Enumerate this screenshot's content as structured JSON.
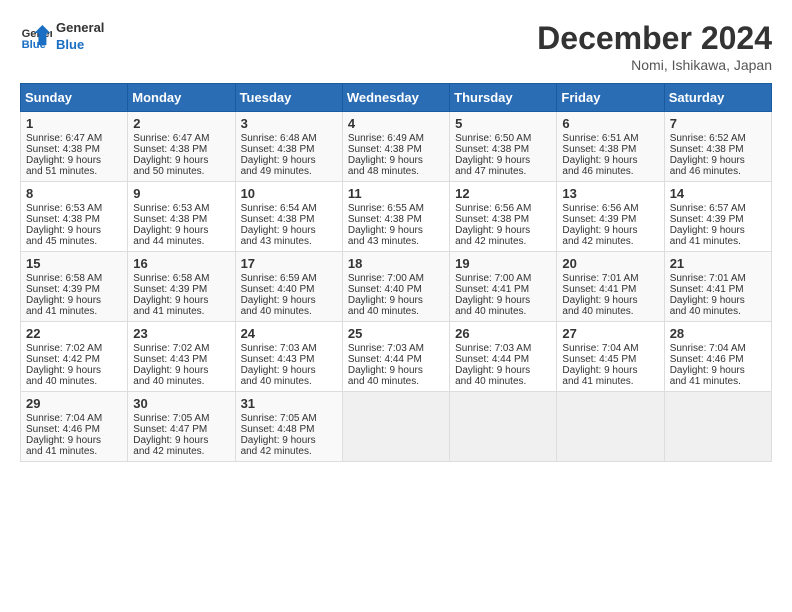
{
  "header": {
    "logo_line1": "General",
    "logo_line2": "Blue",
    "month_title": "December 2024",
    "location": "Nomi, Ishikawa, Japan"
  },
  "weekdays": [
    "Sunday",
    "Monday",
    "Tuesday",
    "Wednesday",
    "Thursday",
    "Friday",
    "Saturday"
  ],
  "weeks": [
    [
      {
        "day": "1",
        "info": "Sunrise: 6:47 AM\nSunset: 4:38 PM\nDaylight: 9 hours\nand 51 minutes."
      },
      {
        "day": "2",
        "info": "Sunrise: 6:47 AM\nSunset: 4:38 PM\nDaylight: 9 hours\nand 50 minutes."
      },
      {
        "day": "3",
        "info": "Sunrise: 6:48 AM\nSunset: 4:38 PM\nDaylight: 9 hours\nand 49 minutes."
      },
      {
        "day": "4",
        "info": "Sunrise: 6:49 AM\nSunset: 4:38 PM\nDaylight: 9 hours\nand 48 minutes."
      },
      {
        "day": "5",
        "info": "Sunrise: 6:50 AM\nSunset: 4:38 PM\nDaylight: 9 hours\nand 47 minutes."
      },
      {
        "day": "6",
        "info": "Sunrise: 6:51 AM\nSunset: 4:38 PM\nDaylight: 9 hours\nand 46 minutes."
      },
      {
        "day": "7",
        "info": "Sunrise: 6:52 AM\nSunset: 4:38 PM\nDaylight: 9 hours\nand 46 minutes."
      }
    ],
    [
      {
        "day": "8",
        "info": "Sunrise: 6:53 AM\nSunset: 4:38 PM\nDaylight: 9 hours\nand 45 minutes."
      },
      {
        "day": "9",
        "info": "Sunrise: 6:53 AM\nSunset: 4:38 PM\nDaylight: 9 hours\nand 44 minutes."
      },
      {
        "day": "10",
        "info": "Sunrise: 6:54 AM\nSunset: 4:38 PM\nDaylight: 9 hours\nand 43 minutes."
      },
      {
        "day": "11",
        "info": "Sunrise: 6:55 AM\nSunset: 4:38 PM\nDaylight: 9 hours\nand 43 minutes."
      },
      {
        "day": "12",
        "info": "Sunrise: 6:56 AM\nSunset: 4:38 PM\nDaylight: 9 hours\nand 42 minutes."
      },
      {
        "day": "13",
        "info": "Sunrise: 6:56 AM\nSunset: 4:39 PM\nDaylight: 9 hours\nand 42 minutes."
      },
      {
        "day": "14",
        "info": "Sunrise: 6:57 AM\nSunset: 4:39 PM\nDaylight: 9 hours\nand 41 minutes."
      }
    ],
    [
      {
        "day": "15",
        "info": "Sunrise: 6:58 AM\nSunset: 4:39 PM\nDaylight: 9 hours\nand 41 minutes."
      },
      {
        "day": "16",
        "info": "Sunrise: 6:58 AM\nSunset: 4:39 PM\nDaylight: 9 hours\nand 41 minutes."
      },
      {
        "day": "17",
        "info": "Sunrise: 6:59 AM\nSunset: 4:40 PM\nDaylight: 9 hours\nand 40 minutes."
      },
      {
        "day": "18",
        "info": "Sunrise: 7:00 AM\nSunset: 4:40 PM\nDaylight: 9 hours\nand 40 minutes."
      },
      {
        "day": "19",
        "info": "Sunrise: 7:00 AM\nSunset: 4:41 PM\nDaylight: 9 hours\nand 40 minutes."
      },
      {
        "day": "20",
        "info": "Sunrise: 7:01 AM\nSunset: 4:41 PM\nDaylight: 9 hours\nand 40 minutes."
      },
      {
        "day": "21",
        "info": "Sunrise: 7:01 AM\nSunset: 4:41 PM\nDaylight: 9 hours\nand 40 minutes."
      }
    ],
    [
      {
        "day": "22",
        "info": "Sunrise: 7:02 AM\nSunset: 4:42 PM\nDaylight: 9 hours\nand 40 minutes."
      },
      {
        "day": "23",
        "info": "Sunrise: 7:02 AM\nSunset: 4:43 PM\nDaylight: 9 hours\nand 40 minutes."
      },
      {
        "day": "24",
        "info": "Sunrise: 7:03 AM\nSunset: 4:43 PM\nDaylight: 9 hours\nand 40 minutes."
      },
      {
        "day": "25",
        "info": "Sunrise: 7:03 AM\nSunset: 4:44 PM\nDaylight: 9 hours\nand 40 minutes."
      },
      {
        "day": "26",
        "info": "Sunrise: 7:03 AM\nSunset: 4:44 PM\nDaylight: 9 hours\nand 40 minutes."
      },
      {
        "day": "27",
        "info": "Sunrise: 7:04 AM\nSunset: 4:45 PM\nDaylight: 9 hours\nand 41 minutes."
      },
      {
        "day": "28",
        "info": "Sunrise: 7:04 AM\nSunset: 4:46 PM\nDaylight: 9 hours\nand 41 minutes."
      }
    ],
    [
      {
        "day": "29",
        "info": "Sunrise: 7:04 AM\nSunset: 4:46 PM\nDaylight: 9 hours\nand 41 minutes."
      },
      {
        "day": "30",
        "info": "Sunrise: 7:05 AM\nSunset: 4:47 PM\nDaylight: 9 hours\nand 42 minutes."
      },
      {
        "day": "31",
        "info": "Sunrise: 7:05 AM\nSunset: 4:48 PM\nDaylight: 9 hours\nand 42 minutes."
      },
      {
        "day": "",
        "info": ""
      },
      {
        "day": "",
        "info": ""
      },
      {
        "day": "",
        "info": ""
      },
      {
        "day": "",
        "info": ""
      }
    ]
  ]
}
